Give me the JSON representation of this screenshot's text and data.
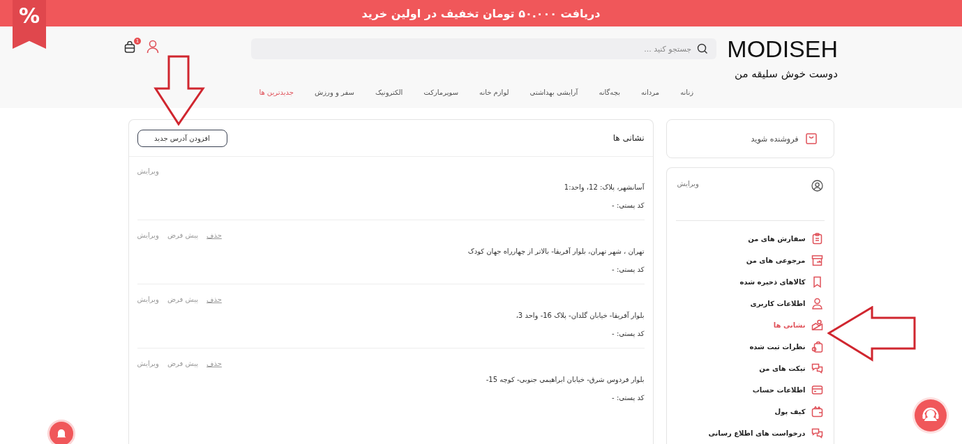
{
  "promo_banner": {
    "text": "دریافت ۵۰.۰۰۰ تومان تخفیف در اولین خرید",
    "ribbon": "%"
  },
  "header": {
    "logo": "MODISEH",
    "tagline": "دوست خوش سلیقه من",
    "search": {
      "placeholder": "جستجو کنید ..."
    },
    "cart_count": "1"
  },
  "nav": [
    {
      "label": "زنانه",
      "selected": false
    },
    {
      "label": "مردانه",
      "selected": false
    },
    {
      "label": "بچه‌گانه",
      "selected": false
    },
    {
      "label": "آرایشی بهداشتی",
      "selected": false
    },
    {
      "label": "لوازم خانه",
      "selected": false
    },
    {
      "label": "سوپرمارکت",
      "selected": false
    },
    {
      "label": "الکترونیک",
      "selected": false
    },
    {
      "label": "سفر و ورزش",
      "selected": false
    },
    {
      "label": "جدیدترین ها",
      "selected": true
    }
  ],
  "sidebar": {
    "seller": "فروشنده شوید",
    "profile_edit": "ویرایش",
    "items": [
      {
        "label": "سفارش های من",
        "selected": false
      },
      {
        "label": "مرجوعی های من",
        "selected": false
      },
      {
        "label": "کالاهای ذخیره شده",
        "selected": false
      },
      {
        "label": "اطلاعات کاربری",
        "selected": false
      },
      {
        "label": "نشانی ها",
        "selected": true
      },
      {
        "label": "نظرات ثبت شده",
        "selected": false
      },
      {
        "label": "تیکت های من",
        "selected": false
      },
      {
        "label": "اطلاعات حساب",
        "selected": false
      },
      {
        "label": "کیف پول",
        "selected": false
      },
      {
        "label": "درخواست های اطلاع رسانی",
        "selected": false
      }
    ]
  },
  "addresses": {
    "title": "نشانی ها",
    "add_button": "افزودن آدرس جدید",
    "items": [
      {
        "actions": [
          {
            "label": "ویرایش",
            "kind": "edit"
          }
        ],
        "address": "آسانشهر، پلاک: 12، واحد:1",
        "postal_code": "کد پستی: -"
      },
      {
        "actions": [
          {
            "label": "حذف",
            "kind": "delete"
          },
          {
            "label": "پیش فرض",
            "kind": "default"
          },
          {
            "label": "ویرایش",
            "kind": "edit"
          }
        ],
        "address": "تهران ، شهر تهران، بلوار آفریقا- بالاتر از چهارراه جهان کودک",
        "postal_code": "کد پستی: -"
      },
      {
        "actions": [
          {
            "label": "حذف",
            "kind": "delete"
          },
          {
            "label": "پیش فرض",
            "kind": "default"
          },
          {
            "label": "ویرایش",
            "kind": "edit"
          }
        ],
        "address": "بلوار آفریقا- خیابان گلدان- پلاک 16- واحد 3،",
        "postal_code": "کد پستی: -"
      },
      {
        "actions": [
          {
            "label": "حذف",
            "kind": "delete"
          },
          {
            "label": "پیش فرض",
            "kind": "default"
          },
          {
            "label": "ویرایش",
            "kind": "edit"
          }
        ],
        "address": "بلوار فردوس شرق- خیابان ابراهیمی جنوبی- کوچه 15-",
        "postal_code": "کد پستی: -"
      }
    ]
  }
}
